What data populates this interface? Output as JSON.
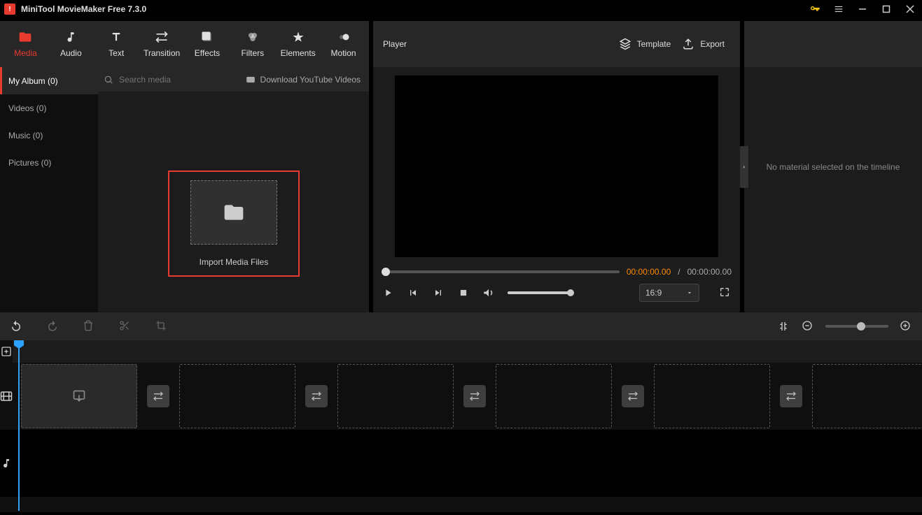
{
  "app": {
    "title": "MiniTool MovieMaker Free 7.3.0"
  },
  "tabs": [
    {
      "id": "media",
      "label": "Media"
    },
    {
      "id": "audio",
      "label": "Audio"
    },
    {
      "id": "text",
      "label": "Text"
    },
    {
      "id": "transition",
      "label": "Transition"
    },
    {
      "id": "effects",
      "label": "Effects"
    },
    {
      "id": "filters",
      "label": "Filters"
    },
    {
      "id": "elements",
      "label": "Elements"
    },
    {
      "id": "motion",
      "label": "Motion"
    }
  ],
  "sidebar": {
    "items": [
      {
        "label": "My Album (0)",
        "active": true
      },
      {
        "label": "Videos (0)"
      },
      {
        "label": "Music (0)"
      },
      {
        "label": "Pictures (0)"
      }
    ]
  },
  "search": {
    "placeholder": "Search media"
  },
  "download_youtube_label": "Download YouTube Videos",
  "import_label": "Import Media Files",
  "player": {
    "title": "Player",
    "template_label": "Template",
    "export_label": "Export",
    "current_time": "00:00:00.00",
    "separator": "/",
    "total_time": "00:00:00.00",
    "aspect": "16:9"
  },
  "inspector": {
    "empty_message": "No material selected on the timeline"
  }
}
